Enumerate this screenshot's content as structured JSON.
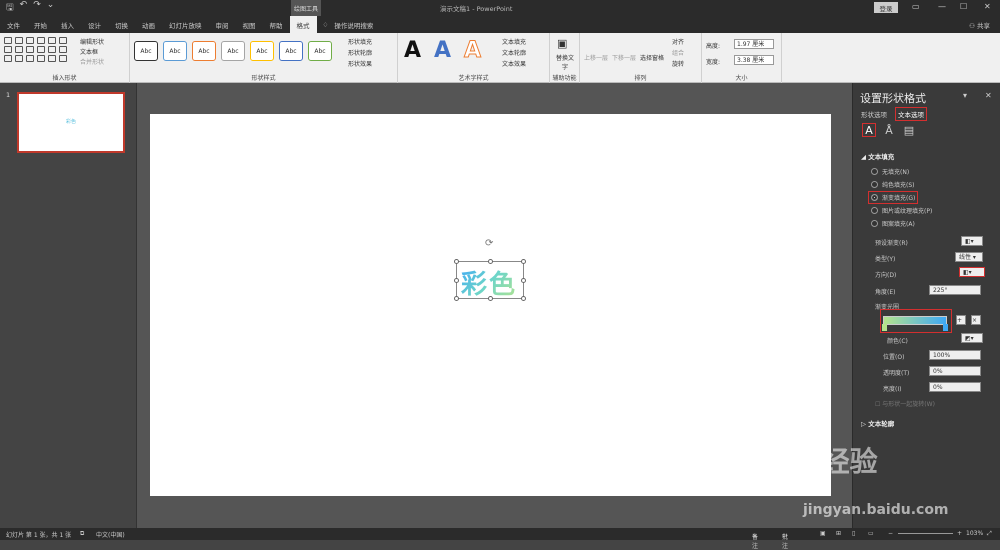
{
  "app": {
    "title": "演示文稿1 - PowerPoint",
    "context_tool": "绘图工具",
    "login": "登录",
    "share": "共享"
  },
  "tabs": [
    "文件",
    "开始",
    "插入",
    "设计",
    "切换",
    "动画",
    "幻灯片放映",
    "审阅",
    "视图",
    "帮助",
    "格式"
  ],
  "tell_me": "操作说明搜索",
  "ribbon": {
    "insert_shapes": {
      "label": "插入形状",
      "edit_shape": "编辑形状",
      "text_box": "文本框",
      "merge_shapes": "合并形状"
    },
    "shape_styles": {
      "label": "形状样式",
      "sample": "Abc",
      "fill": "形状填充",
      "outline": "形状轮廓",
      "effects": "形状效果"
    },
    "wordart": {
      "label": "艺术字样式",
      "sample": "A",
      "text_fill": "文本填充",
      "text_outline": "文本轮廓",
      "text_effects": "文本效果"
    },
    "accessibility": {
      "label": "辅助功能",
      "alt_text": "替换文字"
    },
    "arrange": {
      "label": "排列",
      "bring_forward": "上移一层",
      "send_backward": "下移一层",
      "selection_pane": "选择窗格",
      "align": "对齐",
      "group": "组合",
      "rotate": "旋转"
    },
    "size": {
      "label": "大小",
      "height_label": "高度:",
      "height": "1.97 厘米",
      "width_label": "宽度:",
      "width": "3.38 厘米"
    }
  },
  "thumbnail": {
    "number": "1",
    "text": "彩色"
  },
  "slide": {
    "text": "彩色"
  },
  "format_pane": {
    "title": "设置形状格式",
    "tab_shape": "形状选项",
    "tab_text": "文本选项",
    "text_fill_section": "文本填充",
    "fill_options": [
      "无填充(N)",
      "纯色填充(S)",
      "渐变填充(G)",
      "图片或纹理填充(P)",
      "图案填充(A)"
    ],
    "selected_fill": 2,
    "preset": "预设渐变(R)",
    "type_label": "类型(Y)",
    "type_value": "线性",
    "direction": "方向(D)",
    "angle_label": "角度(E)",
    "angle_value": "225°",
    "gradient_stops": "渐变光圈",
    "color_label": "颜色(C)",
    "position_label": "位置(O)",
    "position_value": "100%",
    "transparency_label": "透明度(T)",
    "transparency_value": "0%",
    "brightness_label": "亮度(I)",
    "brightness_value": "0%",
    "rotate_with_shape": "与形状一起旋转(W)",
    "text_outline_section": "文本轮廓"
  },
  "status": {
    "slide_info": "幻灯片 第 1 张，共 1 张",
    "language": "中文(中国)",
    "notes": "备注",
    "comments": "批注",
    "zoom": "103%"
  },
  "watermark": {
    "brand": "Bai 经验",
    "url": "jingyan.baidu.com"
  },
  "colors": {
    "accent_red": "#d32f2f",
    "grad_start": "#b5e48c",
    "grad_end": "#3fa9f5"
  }
}
